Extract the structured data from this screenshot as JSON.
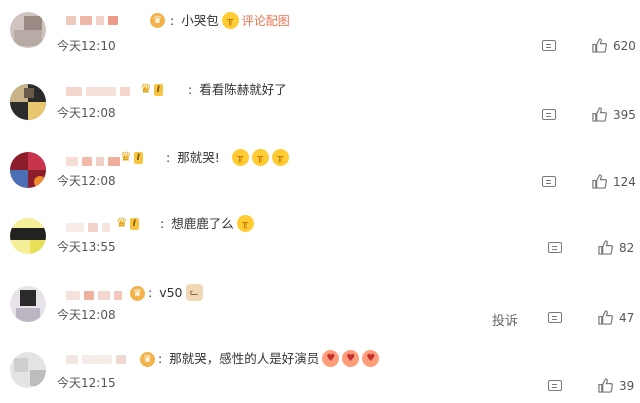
{
  "comments": [
    {
      "text": "小哭包",
      "extra": "评论配图",
      "time": "今天12:10",
      "likes": "620"
    },
    {
      "text": "看看陈赫就好了",
      "time": "今天12:08",
      "likes": "395"
    },
    {
      "text": "那就哭!",
      "time": "今天12:08",
      "likes": "124"
    },
    {
      "text": "想鹿鹿了么",
      "time": "今天13:55",
      "likes": "82"
    },
    {
      "text": "v50",
      "time": "今天12:08",
      "likes": "47",
      "report": "投诉"
    },
    {
      "text": "那就哭，感性的人是好演员",
      "time": "今天12:15",
      "likes": "39"
    }
  ],
  "badge": {
    "level": "I"
  },
  "colors": {
    "link": "#eb7350",
    "badge_gold": "#f5c542",
    "emoji": "#ffcc33"
  }
}
